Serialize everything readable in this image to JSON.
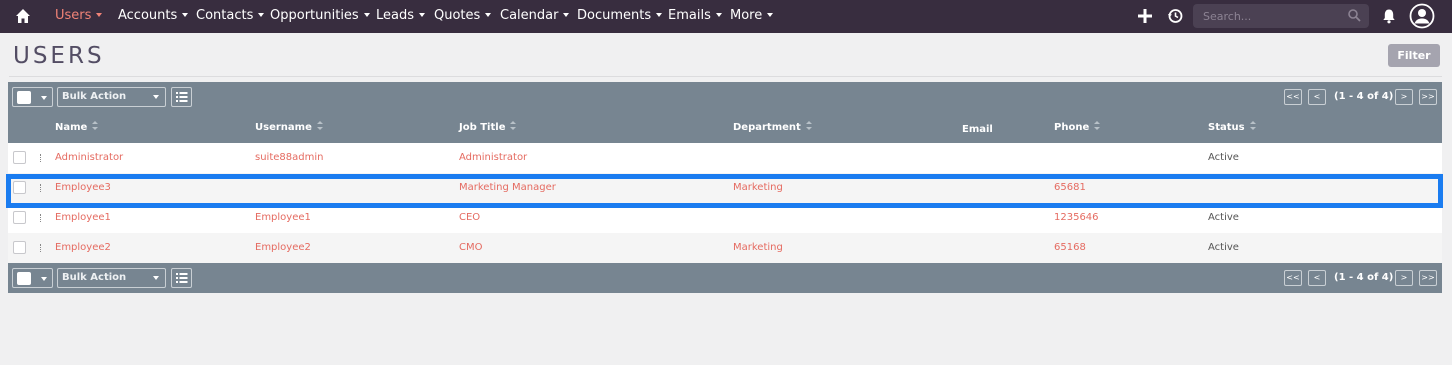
{
  "nav": {
    "items": [
      {
        "label": "Users",
        "active": true
      },
      {
        "label": "Accounts"
      },
      {
        "label": "Contacts"
      },
      {
        "label": "Opportunities"
      },
      {
        "label": "Leads"
      },
      {
        "label": "Quotes"
      },
      {
        "label": "Calendar"
      },
      {
        "label": "Documents"
      },
      {
        "label": "Emails"
      },
      {
        "label": "More"
      }
    ],
    "search_placeholder": "Search..."
  },
  "page": {
    "title": "USERS",
    "filter_label": "Filter"
  },
  "actionbar": {
    "bulk_label": "Bulk Action",
    "first": "<<",
    "prev": "<",
    "next": ">",
    "last": ">>",
    "count": "(1 - 4 of 4)"
  },
  "table": {
    "columns": [
      "Name",
      "Username",
      "Job Title",
      "Department",
      "Email",
      "Phone",
      "Status"
    ],
    "rows": [
      {
        "name": "Administrator",
        "username": "suite88admin",
        "job_title": "Administrator",
        "department": "",
        "email": "",
        "phone": "",
        "status": "Active"
      },
      {
        "name": "Employee3",
        "username": "",
        "job_title": "Marketing Manager",
        "department": "Marketing",
        "email": "",
        "phone": "65681",
        "status": ""
      },
      {
        "name": "Employee1",
        "username": "Employee1",
        "job_title": "CEO",
        "department": "",
        "email": "",
        "phone": "1235646",
        "status": "Active"
      },
      {
        "name": "Employee2",
        "username": "Employee2",
        "job_title": "CMO",
        "department": "Marketing",
        "email": "",
        "phone": "65168",
        "status": "Active"
      }
    ]
  },
  "colors": {
    "nav_bg": "#382d3f",
    "accent": "#f08377",
    "link": "#e56b61",
    "bar": "#778591",
    "highlight": "#1a7cf0"
  }
}
